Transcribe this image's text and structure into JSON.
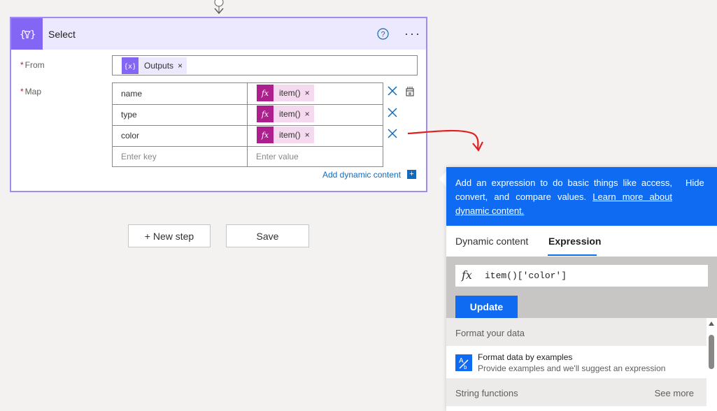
{
  "card": {
    "title": "Select",
    "from_label": "From",
    "map_label": "Map",
    "required_mark": "*",
    "from_token": "Outputs",
    "token_close": "×",
    "map_rows": [
      {
        "key": "name",
        "value": "item()"
      },
      {
        "key": "type",
        "value": "item()"
      },
      {
        "key": "color",
        "value": "item()"
      }
    ],
    "key_placeholder": "Enter key",
    "value_placeholder": "Enter value",
    "add_dynamic_content": "Add dynamic content",
    "add_dynamic_icon": "+",
    "more_label": "···"
  },
  "buttons": {
    "new_step": "+ New step",
    "save": "Save"
  },
  "panel": {
    "info_text": "Add an expression to do basic things like access, convert, and compare values.",
    "info_link": "Learn more about dynamic content.",
    "hide": "Hide",
    "tabs": [
      "Dynamic content",
      "Expression"
    ],
    "active_tab": "Expression",
    "fx_label": "fx",
    "expression_value": "item()['color']",
    "update_label": "Update",
    "sections": {
      "format": "Format your data",
      "string": "String functions",
      "see_more": "See more"
    },
    "func": {
      "title": "Format data by examples",
      "desc": "Provide examples and we'll suggest an expression"
    }
  },
  "colors": {
    "select_accent": "#8466f5",
    "expression_token": "#ad1f8d",
    "primary_blue": "#0f6cf2",
    "annotation_red": "#e02020"
  },
  "icons": {
    "card": "select-data-operation-icon",
    "help": "question-circle-icon",
    "row_delete": "close-x-icon",
    "switch_mode": "switch-to-text-mode-icon",
    "function": "format-by-example-icon"
  }
}
